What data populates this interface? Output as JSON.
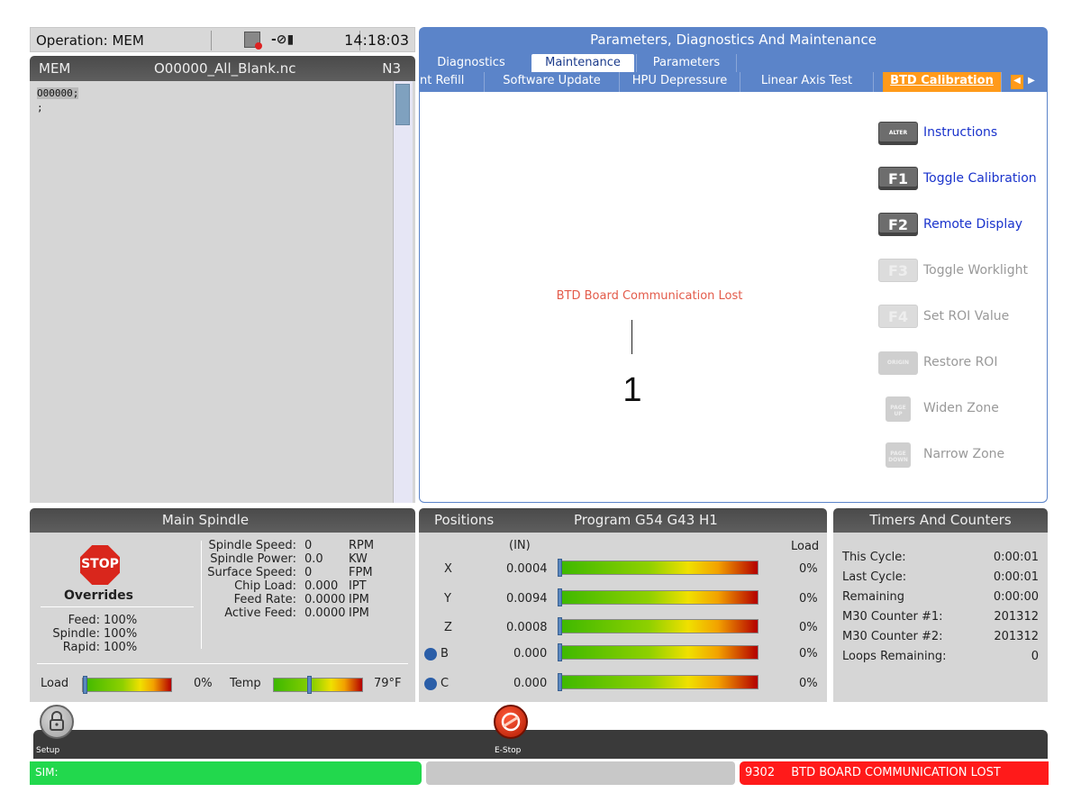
{
  "header": {
    "operation": "Operation: MEM",
    "clock": "14:18:03"
  },
  "program": {
    "mode": "MEM",
    "filename": "O00000_All_Blank.nc",
    "line": "N3",
    "code_lines": [
      "O00000;",
      ";"
    ]
  },
  "panel": {
    "title": "Parameters, Diagnostics And Maintenance",
    "tabs": [
      "Diagnostics",
      "Maintenance",
      "Parameters"
    ],
    "subtabs": [
      "nt Refill",
      "Software Update",
      "HPU Depressure",
      "Linear Axis Test",
      "BTD Calibration"
    ],
    "message": "BTD Board Communication Lost",
    "value": "1",
    "actions": [
      {
        "key": "ALTER",
        "label": "Instructions",
        "enabled": true
      },
      {
        "key": "F1",
        "label": "Toggle Calibration",
        "enabled": true
      },
      {
        "key": "F2",
        "label": "Remote Display",
        "enabled": true
      },
      {
        "key": "F3",
        "label": "Toggle Worklight",
        "enabled": false
      },
      {
        "key": "F4",
        "label": "Set ROI Value",
        "enabled": false
      },
      {
        "key": "ORIGIN",
        "label": "Restore ROI",
        "enabled": false
      },
      {
        "key": "PAGE UP",
        "label": "Widen Zone",
        "enabled": false
      },
      {
        "key": "PAGE DOWN",
        "label": "Narrow Zone",
        "enabled": false
      }
    ]
  },
  "spindle": {
    "title": "Main Spindle",
    "stop_label": "STOP",
    "overrides_title": "Overrides",
    "overrides": [
      {
        "label": "Feed:",
        "value": "100%"
      },
      {
        "label": "Spindle:",
        "value": "100%"
      },
      {
        "label": "Rapid:",
        "value": "100%"
      }
    ],
    "stats": [
      {
        "label": "Spindle Speed:",
        "value": "0",
        "unit": "RPM"
      },
      {
        "label": "Spindle Power:",
        "value": "0.0",
        "unit": "KW"
      },
      {
        "label": "Surface Speed:",
        "value": "0",
        "unit": "FPM"
      },
      {
        "label": "Chip Load:",
        "value": "0.000",
        "unit": "IPT"
      },
      {
        "label": "Feed Rate:",
        "value": "0.0000",
        "unit": "IPM"
      },
      {
        "label": "Active Feed:",
        "value": "0.0000",
        "unit": "IPM"
      }
    ],
    "load_label": "Load",
    "load_value": "0%",
    "load_fraction": 0.0,
    "temp_label": "Temp",
    "temp_value": "79°F",
    "temp_fraction": 0.4
  },
  "positions": {
    "title": "Positions",
    "program": "Program G54 G43 H1",
    "units": "(IN)",
    "load_header": "Load",
    "axes": [
      {
        "axis": "X",
        "value": "0.0004",
        "load": "0%",
        "home": false
      },
      {
        "axis": "Y",
        "value": "0.0094",
        "load": "0%",
        "home": false
      },
      {
        "axis": "Z",
        "value": "0.0008",
        "load": "0%",
        "home": false
      },
      {
        "axis": "B",
        "value": "0.000",
        "load": "0%",
        "home": true
      },
      {
        "axis": "C",
        "value": "0.000",
        "load": "0%",
        "home": true
      }
    ]
  },
  "timers": {
    "title": "Timers And Counters",
    "rows": [
      {
        "label": "This Cycle:",
        "value": "0:00:01"
      },
      {
        "label": "Last Cycle:",
        "value": "0:00:01"
      },
      {
        "label": "Remaining",
        "value": "0:00:00"
      },
      {
        "label": "M30 Counter #1:",
        "value": "201312"
      },
      {
        "label": "M30 Counter #2:",
        "value": "201312"
      },
      {
        "label": "Loops Remaining:",
        "value": "0"
      }
    ]
  },
  "buttons": {
    "setup": "Setup",
    "estop": "E-Stop"
  },
  "status": {
    "left": "SIM:",
    "alarm_code": "9302",
    "alarm_text": "BTD BOARD COMMUNICATION LOST"
  },
  "colors": {
    "panel_blue": "#5b84c9",
    "active_tab": "#ff9a1a",
    "alarm_red": "#ff1a1a",
    "status_green": "#22d84d",
    "error_text": "#e35b4a"
  }
}
